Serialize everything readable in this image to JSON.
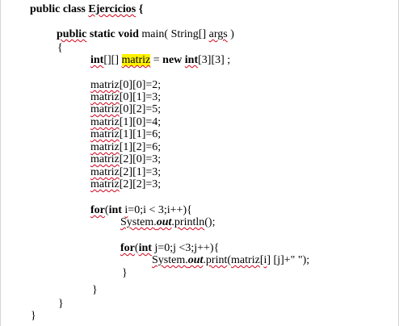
{
  "doc": {
    "l1": [
      "public class ",
      "Ejercicios",
      " {"
    ],
    "l2": [
      "public",
      " static void ",
      "main( String[] ",
      "args",
      " )"
    ],
    "l3": "{",
    "l4": [
      "int",
      "[][] ",
      "matriz",
      " = ",
      "new ",
      "int",
      "[3][3] ;"
    ],
    "assign": [
      [
        "matriz",
        "[0][0]=2;"
      ],
      [
        "matriz",
        "[0][1]=3;"
      ],
      [
        "matriz",
        "[0][2]=5;"
      ],
      [
        "matriz",
        "[1][0]=4;"
      ],
      [
        "matriz",
        "[1][1]=6;"
      ],
      [
        "matriz",
        "[1][2]=6;"
      ],
      [
        "matriz",
        "[2][0]=3;"
      ],
      [
        "matriz",
        "[2][1]=3;"
      ],
      [
        "matriz",
        "[2][2]=3;"
      ]
    ],
    "for1": [
      "for",
      "(",
      "int",
      " ",
      "i",
      "=0;i < 3;i++){"
    ],
    "println": [
      "System.",
      "out",
      ".",
      "println",
      "();"
    ],
    "for2": [
      "for",
      "(",
      "int",
      " j=0;j <3;j++){"
    ],
    "print": [
      "System.",
      "out",
      ".",
      "print",
      "(",
      "matriz",
      "[",
      "i",
      "] [j]+\" \");"
    ],
    "close": "}"
  }
}
